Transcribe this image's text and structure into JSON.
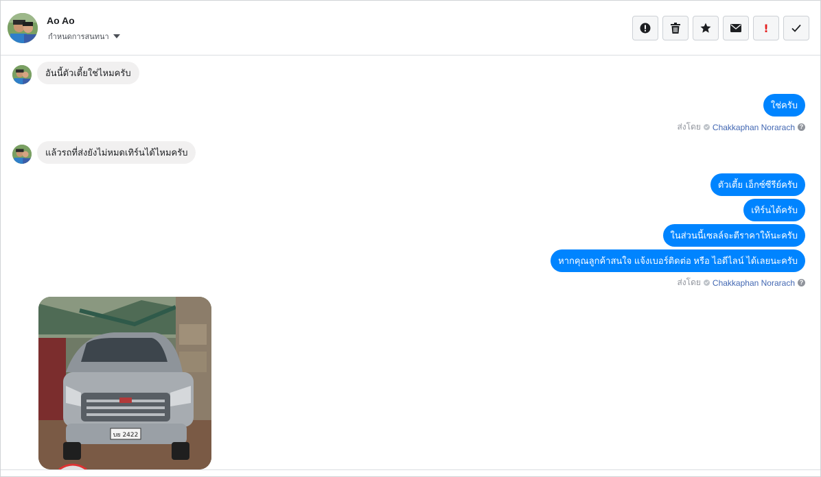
{
  "header": {
    "contact_name": "Ao Ao",
    "assign_label": "กำหนดการสนทนา",
    "toolbar": [
      {
        "name": "spam-button",
        "icon": "alert-circle-icon",
        "label": ""
      },
      {
        "name": "delete-button",
        "icon": "trash-icon",
        "label": ""
      },
      {
        "name": "star-button",
        "icon": "star-icon",
        "label": ""
      },
      {
        "name": "mark-unread-button",
        "icon": "envelope-icon",
        "label": ""
      },
      {
        "name": "follow-up-button",
        "icon": "exclamation-icon",
        "label": "!"
      },
      {
        "name": "done-button",
        "icon": "check-icon",
        "label": ""
      }
    ]
  },
  "messages": {
    "in_1": "อันนี้ตัวเตี้ยใช่ไหมครับ",
    "out_1": [
      "ใช่ครับ"
    ],
    "sent_by_1": {
      "prefix": "ส่งโดย",
      "sender": "Chakkaphan Norarach"
    },
    "in_2": "แล้วรถที่ส่งยังไม่หมดเทิร์นได้ไหมครับ",
    "out_2": [
      "ตัวเตี้ย เอ็กซ์ซีรีย์ครับ",
      "เทิร์นได้ครับ",
      "ในส่วนนี้เซลล์จะตีราคาให้นะครับ",
      "หากคุณลูกค้าสนใจ แจ้งเบอร์ติดต่อ หรือ ไอดีไลน์ ได้เลยนะครับ"
    ],
    "sent_by_2": {
      "prefix": "ส่งโดย",
      "sender": "Chakkaphan Norarach"
    },
    "photo_plate": "บย 2422"
  },
  "colors": {
    "outgoing_bubble": "#0084ff",
    "incoming_bubble": "#f1f0f0",
    "link": "#4267b2",
    "accent_red": "#e41e1e"
  }
}
